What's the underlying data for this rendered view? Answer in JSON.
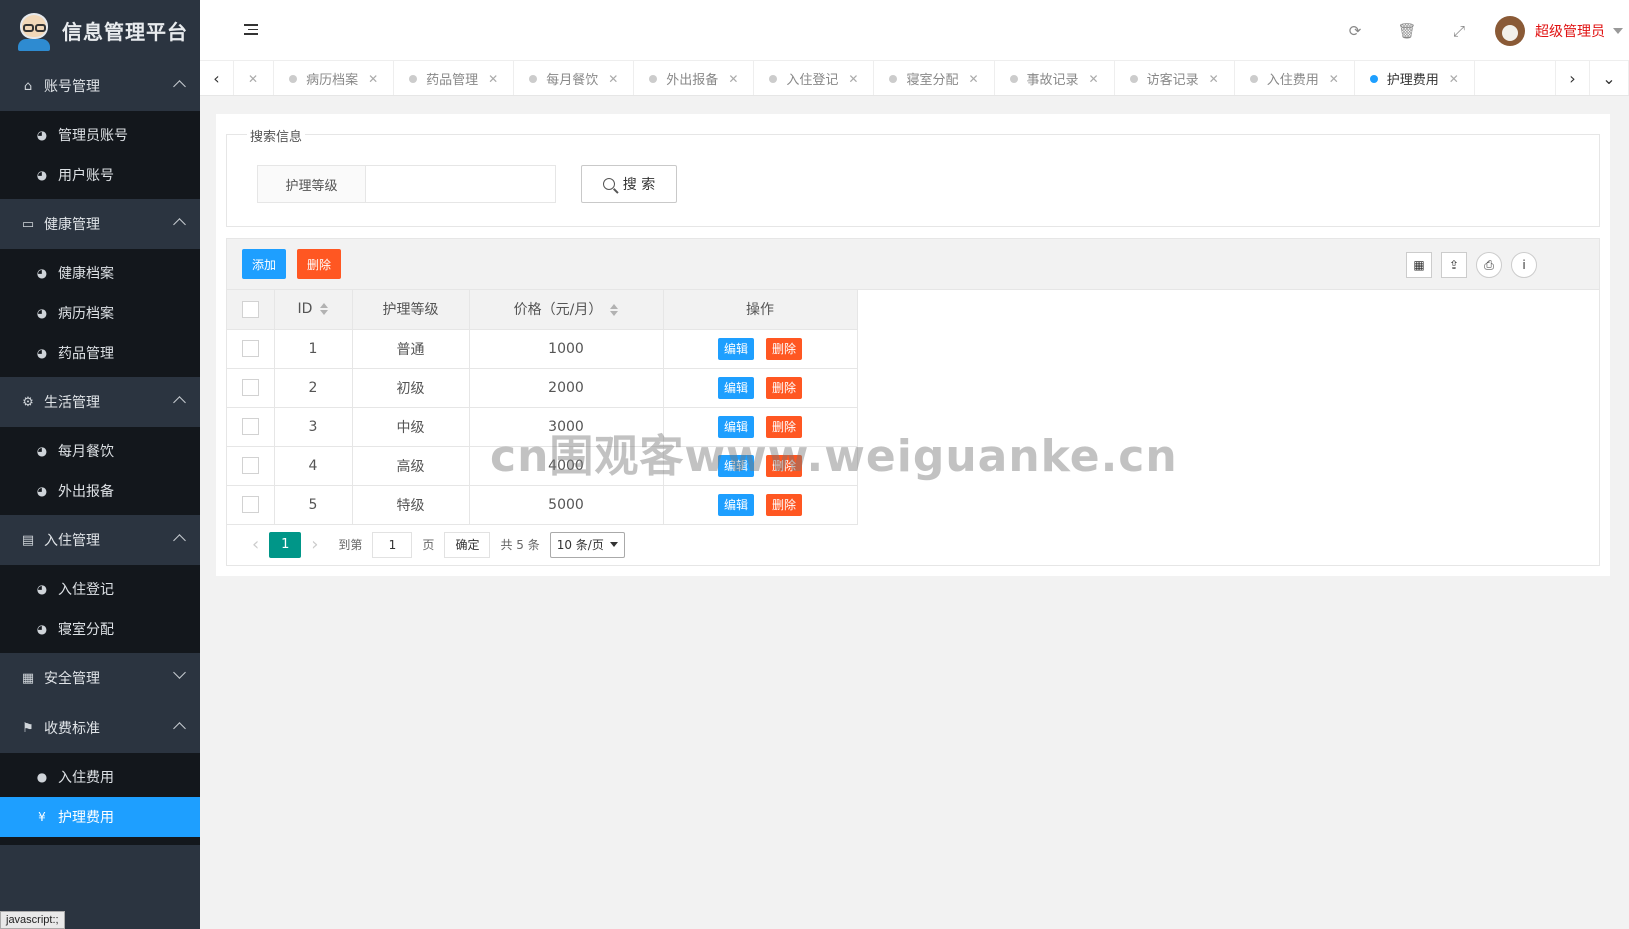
{
  "app": {
    "title": "信息管理平台"
  },
  "sidebar": {
    "groups": [
      {
        "label": "账号管理",
        "icon": "home-icon",
        "items": [
          {
            "label": "管理员账号"
          },
          {
            "label": "用户账号"
          }
        ]
      },
      {
        "label": "健康管理",
        "icon": "window-icon",
        "items": [
          {
            "label": "健康档案"
          },
          {
            "label": "病历档案"
          },
          {
            "label": "药品管理"
          }
        ]
      },
      {
        "label": "生活管理",
        "icon": "gears-icon",
        "items": [
          {
            "label": "每月餐饮"
          },
          {
            "label": "外出报备"
          }
        ]
      },
      {
        "label": "入住管理",
        "icon": "file-icon",
        "items": [
          {
            "label": "入住登记"
          },
          {
            "label": "寝室分配"
          }
        ]
      },
      {
        "label": "安全管理",
        "icon": "calendar-icon",
        "items": []
      },
      {
        "label": "收费标准",
        "icon": "flag-icon",
        "items": [
          {
            "label": "入住费用"
          },
          {
            "label": "护理费用"
          }
        ]
      }
    ]
  },
  "status_tip": "javascript:;",
  "topbar": {
    "user_name": "超级管理员"
  },
  "tabs": [
    {
      "label": "​"
    },
    {
      "label": "病历档案"
    },
    {
      "label": "药品管理"
    },
    {
      "label": "每月餐饮"
    },
    {
      "label": "外出报备"
    },
    {
      "label": "入住登记"
    },
    {
      "label": "寝室分配"
    },
    {
      "label": "事故记录"
    },
    {
      "label": "访客记录"
    },
    {
      "label": "入住费用"
    },
    {
      "label": "护理费用"
    }
  ],
  "search": {
    "legend": "搜索信息",
    "field_label": "护理等级",
    "field_value": "",
    "button_label": "搜 索"
  },
  "toolbar": {
    "add_label": "添加",
    "delete_label": "删除"
  },
  "table": {
    "headers": [
      "ID",
      "护理等级",
      "价格（元/月）",
      "操作"
    ],
    "rows": [
      {
        "id": "1",
        "level": "普通",
        "price": "1000"
      },
      {
        "id": "2",
        "level": "初级",
        "price": "2000"
      },
      {
        "id": "3",
        "level": "中级",
        "price": "3000"
      },
      {
        "id": "4",
        "level": "高级",
        "price": "4000"
      },
      {
        "id": "5",
        "level": "特级",
        "price": "5000"
      }
    ],
    "edit_label": "编辑",
    "delete_label": "删除"
  },
  "pager": {
    "current": "1",
    "goto_label": "到第",
    "goto_value": "1",
    "page_label": "页",
    "ok_label": "确定",
    "total": "共 5 条",
    "limit": "10 条/页"
  },
  "watermark": "cn围观客www.weiguanke.cn",
  "colors": {
    "sidebar_bg": "#2b3440",
    "accent": "#1e9fff",
    "danger": "#ff5722",
    "pager_active": "#009688",
    "user_name": "#e01212"
  }
}
